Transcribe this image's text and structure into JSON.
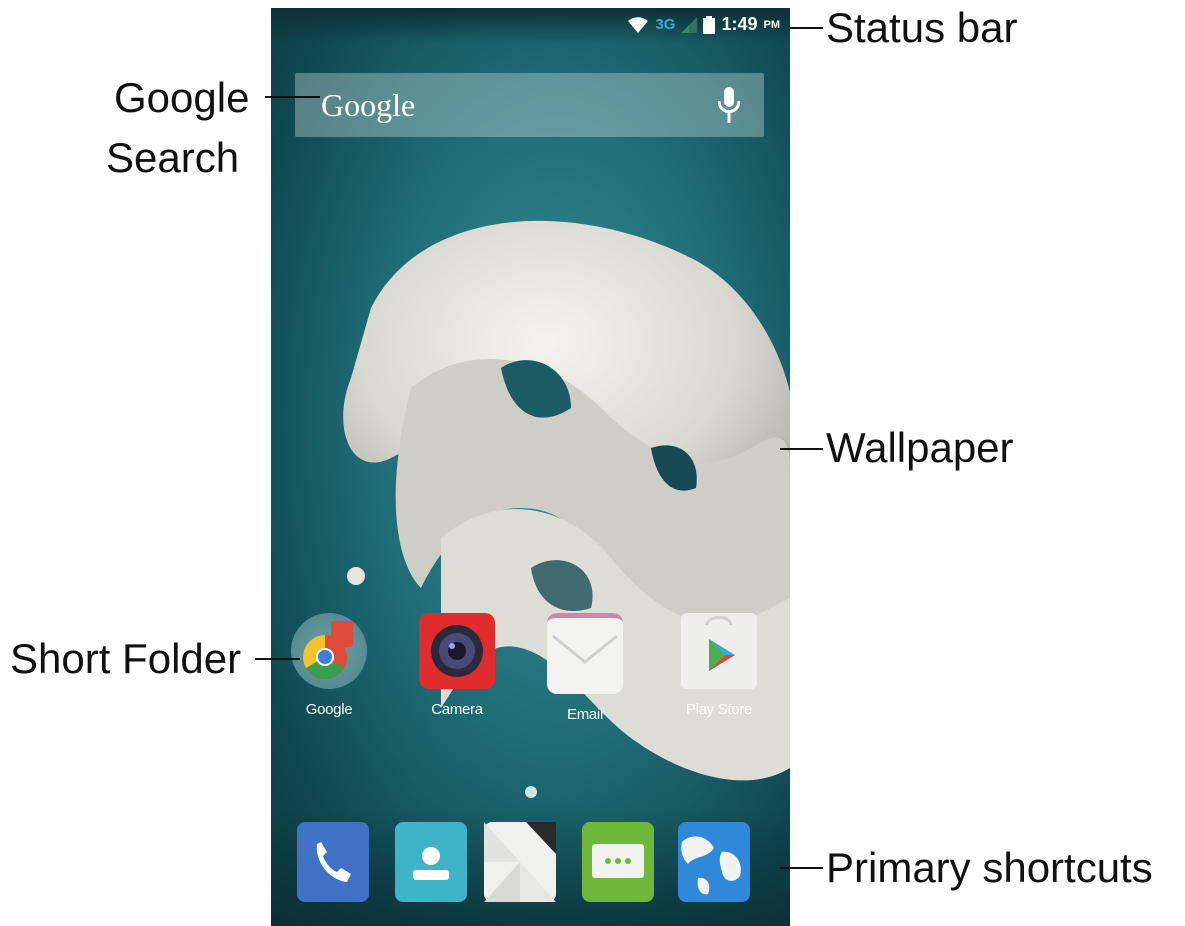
{
  "status_bar": {
    "network": "3G",
    "time": "1:49",
    "ampm": "PM"
  },
  "search": {
    "text": "Google",
    "icon": "mic-icon"
  },
  "apps": [
    {
      "label": "Google",
      "icon": "chrome-folder-icon"
    },
    {
      "label": "Camera",
      "icon": "camera-icon"
    },
    {
      "label": "Email",
      "icon": "email-icon"
    },
    {
      "label": "Play Store",
      "icon": "play-store-icon"
    }
  ],
  "dock": [
    {
      "icon": "phone-icon"
    },
    {
      "icon": "contacts-icon"
    },
    {
      "icon": "app-drawer-icon"
    },
    {
      "icon": "messaging-icon"
    },
    {
      "icon": "browser-globe-icon"
    }
  ],
  "callouts": {
    "status_bar": "Status bar",
    "google_search_1": "Google",
    "google_search_2": "Search",
    "wallpaper": "Wallpaper",
    "short_folder": "Short Folder",
    "primary_shortcuts": "Primary shortcuts"
  },
  "colors": {
    "wallpaper_teal": "#1f6d76",
    "sculpture": "#e8e6e1",
    "accent_blue": "#3aa8d8"
  }
}
